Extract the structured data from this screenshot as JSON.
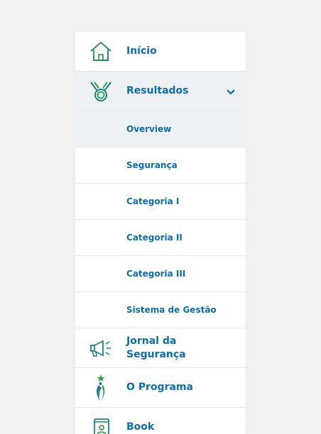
{
  "menu": {
    "items": [
      {
        "label": "Início",
        "icon": "house-icon"
      },
      {
        "label": "Resultados",
        "icon": "medal-icon",
        "expanded": true
      }
    ],
    "subitems": [
      {
        "label": "Overview",
        "selected": true
      },
      {
        "label": "Segurança"
      },
      {
        "label": "Categoria I"
      },
      {
        "label": "Categoria II"
      },
      {
        "label": "Categoria III"
      },
      {
        "label": "Sistema de Gestão"
      }
    ],
    "bottom": [
      {
        "label_line1": "Jornal da",
        "label_line2": "Segurança",
        "icon": "megaphone-icon"
      },
      {
        "label": "O Programa",
        "icon": "runner-star-icon"
      },
      {
        "label": "Book",
        "icon": "book-icon"
      }
    ]
  },
  "colors": {
    "background": "#f1f1f1",
    "panel": "#ffffff",
    "active_row": "#eef1f4",
    "text_blue": "#0b6eb0",
    "icon_green": "#3aa24a",
    "icon_teal": "#1f7f8f",
    "divider": "#e6e9ec"
  }
}
